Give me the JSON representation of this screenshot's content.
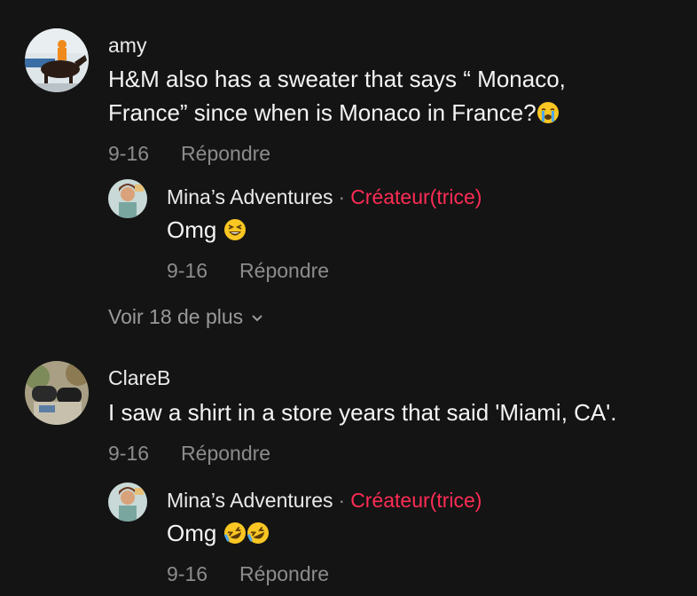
{
  "comments": [
    {
      "author": "amy",
      "line1": "H&M also has a sweater that says “ Monaco,",
      "line2": "France” since when is Monaco in France?",
      "emoji": "loudly-crying-face",
      "date": "9-16",
      "reply": "Répondre",
      "replies": [
        {
          "author": "Mina’s Adventures",
          "separator": "·",
          "badge": "Créateur(trice)",
          "text": "Omg",
          "emoji": "grinning-squinting-face",
          "date": "9-16",
          "reply": "Répondre"
        }
      ],
      "view_more": "Voir 18 de plus"
    },
    {
      "author": "ClareB",
      "line1": "I saw a shirt in a store years that said 'Miami, CA'.",
      "date": "9-16",
      "reply": "Répondre",
      "replies": [
        {
          "author": "Mina’s Adventures",
          "separator": "·",
          "badge": "Créateur(trice)",
          "text": "Omg",
          "emoji": "rolling-on-floor-laughing x2",
          "date": "9-16",
          "reply": "Répondre"
        }
      ]
    }
  ],
  "colors": {
    "background": "#141414",
    "creator_badge": "#fe2c55",
    "muted": "#8c8c8c"
  }
}
